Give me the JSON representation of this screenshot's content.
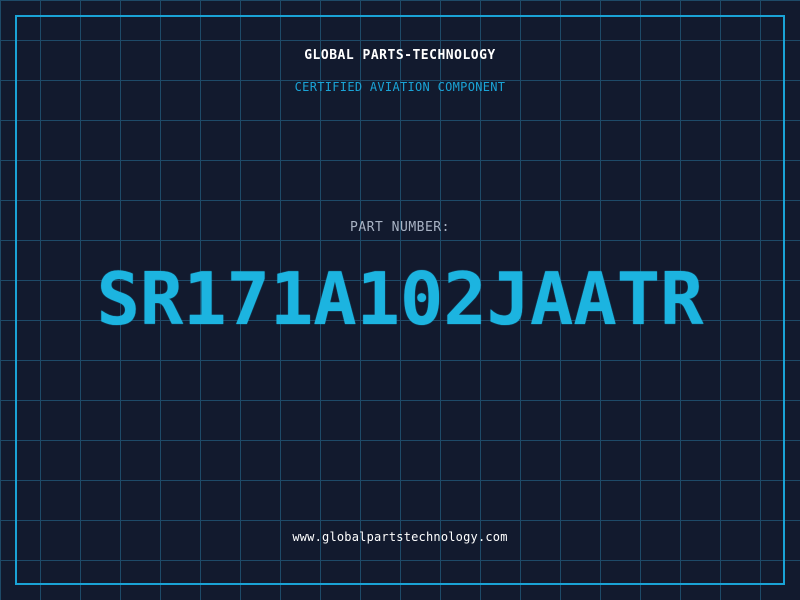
{
  "header": {
    "company": "GLOBAL PARTS-TECHNOLOGY",
    "subtitle": "CERTIFIED AVIATION COMPONENT"
  },
  "part": {
    "label": "PART NUMBER:",
    "number": "SR171A102JAATR"
  },
  "footer": {
    "website": "www.globalpartstechnology.com"
  },
  "colors": {
    "background": "#121a2e",
    "grid": "#1e4a68",
    "accent": "#1aa3d6",
    "part_number": "#1cb4e0",
    "label": "#a9b3c4",
    "text": "#ffffff"
  }
}
